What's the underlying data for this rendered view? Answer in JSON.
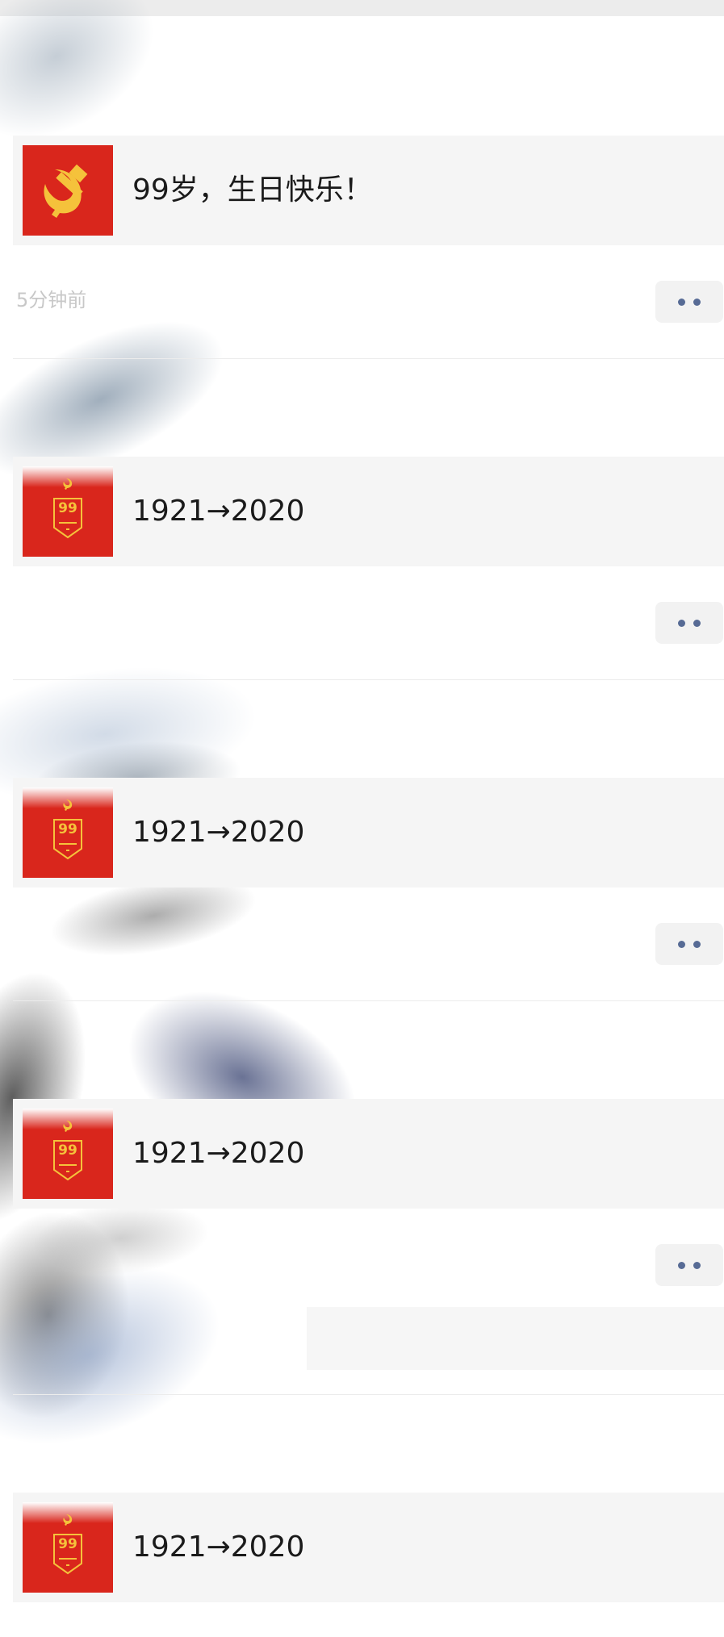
{
  "feed": {
    "timestamp": "5分钟前",
    "items": [
      {
        "title": "99岁，生日快乐！",
        "thumb_icon": "hammer-and-sickle-icon"
      },
      {
        "title": "1921→2020",
        "thumb_icon": "anniversary-99-badge-icon",
        "badge_number": "99"
      },
      {
        "title": "1921→2020",
        "thumb_icon": "anniversary-99-badge-icon",
        "badge_number": "99"
      },
      {
        "title": "1921→2020",
        "thumb_icon": "anniversary-99-badge-icon",
        "badge_number": "99"
      },
      {
        "title": "1921→2020",
        "thumb_icon": "anniversary-99-badge-icon",
        "badge_number": "99"
      }
    ],
    "more_button_icon": "more-dots-icon"
  },
  "colors": {
    "thumb_red": "#d9261c",
    "emblem_gold": "#f5c23b",
    "dots_blue": "#576b95",
    "card_bg": "#f5f5f5"
  }
}
